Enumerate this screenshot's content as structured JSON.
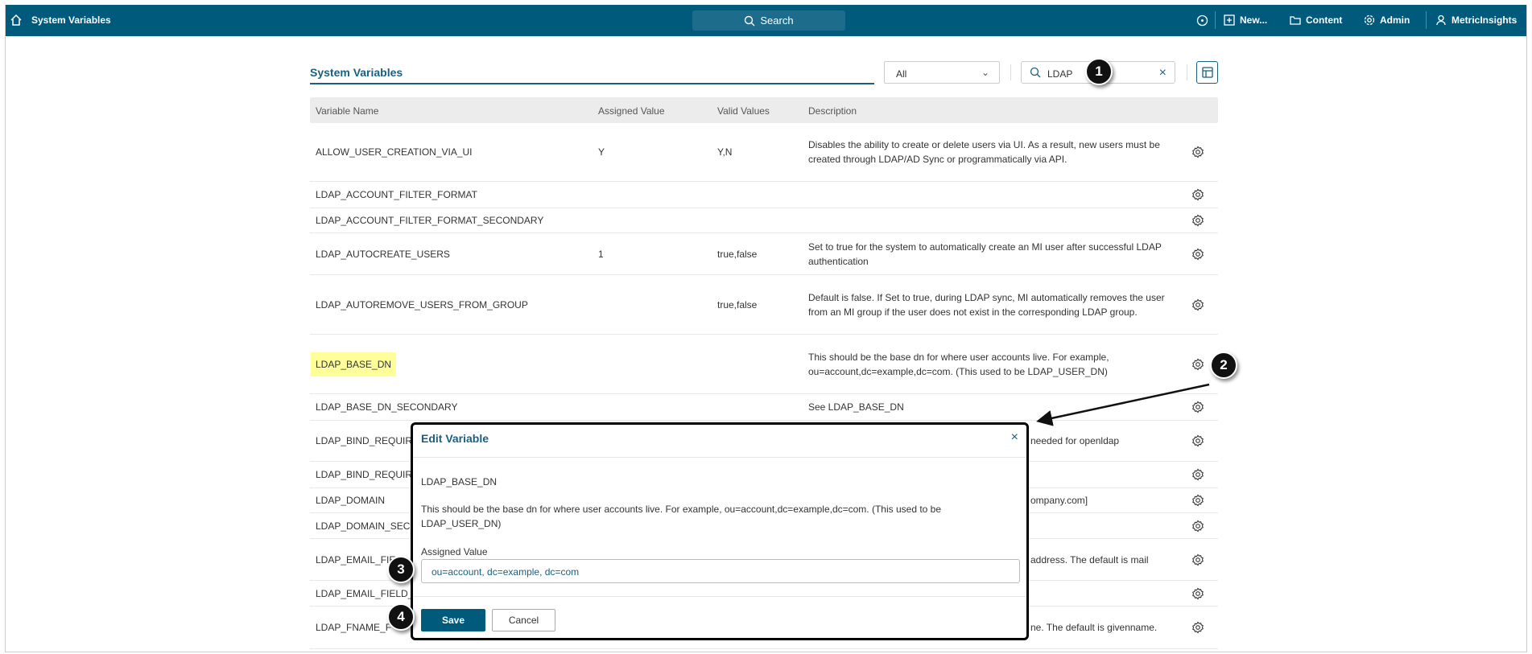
{
  "topbar": {
    "title": "System Variables",
    "search": "Search",
    "new": "New...",
    "content": "Content",
    "admin": "Admin",
    "user": "MetricInsights"
  },
  "page": {
    "title": "System Variables",
    "filter_value": "All",
    "search_value": "LDAP"
  },
  "table": {
    "headers": [
      "Variable Name",
      "Assigned Value",
      "Valid Values",
      "Description"
    ],
    "rows": [
      {
        "name": "ALLOW_USER_CREATION_VIA_UI",
        "assigned": "Y",
        "valid": "Y,N",
        "desc": "Disables the ability to create or delete users via UI. As a result, new users must be created through LDAP/AD Sync or programmatically via API."
      },
      {
        "name": "LDAP_ACCOUNT_FILTER_FORMAT",
        "assigned": "",
        "valid": "",
        "desc": ""
      },
      {
        "name": "LDAP_ACCOUNT_FILTER_FORMAT_SECONDARY",
        "assigned": "",
        "valid": "",
        "desc": ""
      },
      {
        "name": "LDAP_AUTOCREATE_USERS",
        "assigned": "1",
        "valid": "true,false",
        "desc": "Set to true for the system to automatically create an MI user after successful LDAP authentication"
      },
      {
        "name": "LDAP_AUTOREMOVE_USERS_FROM_GROUP",
        "assigned": "",
        "valid": "true,false",
        "desc": "Default is false. If Set to true, during LDAP sync, MI automatically removes the user from an MI group if the user does not exist in the corresponding LDAP group."
      },
      {
        "name": "LDAP_BASE_DN",
        "assigned": "",
        "valid": "",
        "desc": "This should be the base dn for where user accounts live. For example, ou=account,dc=example,dc=com. (This used to be LDAP_USER_DN)",
        "highlight": true
      },
      {
        "name": "LDAP_BASE_DN_SECONDARY",
        "assigned": "",
        "valid": "",
        "desc": "See LDAP_BASE_DN"
      },
      {
        "name": "LDAP_BIND_REQUIR",
        "assigned": "",
        "valid": "",
        "desc_tail": "needed for openldap"
      },
      {
        "name": "LDAP_BIND_REQUIR",
        "assigned": "",
        "valid": "",
        "desc": ""
      },
      {
        "name": "LDAP_DOMAIN",
        "assigned": "",
        "valid": "",
        "desc_tail": "ompany.com]"
      },
      {
        "name": "LDAP_DOMAIN_SEC",
        "assigned": "",
        "valid": "",
        "desc": ""
      },
      {
        "name": "LDAP_EMAIL_FIE",
        "assigned": "",
        "valid": "",
        "desc_tail": "address. The default is mail"
      },
      {
        "name": "LDAP_EMAIL_FIELD_",
        "assigned": "",
        "valid": "",
        "desc": ""
      },
      {
        "name": "LDAP_FNAME_F",
        "assigned": "",
        "valid": "",
        "desc_tail": "ne. The default is givenname."
      }
    ]
  },
  "modal": {
    "title": "Edit Variable",
    "var_name": "LDAP_BASE_DN",
    "description": "This should be the base dn for where user accounts live. For example, ou=account,dc=example,dc=com. (This used to be LDAP_USER_DN)",
    "field_label": "Assigned Value",
    "field_value": "ou=account, dc=example, dc=com",
    "save": "Save",
    "cancel": "Cancel"
  },
  "callouts": [
    "1",
    "2",
    "3",
    "4"
  ],
  "colors": {
    "brand": "#005a7c",
    "highlight": "#ffff99"
  }
}
